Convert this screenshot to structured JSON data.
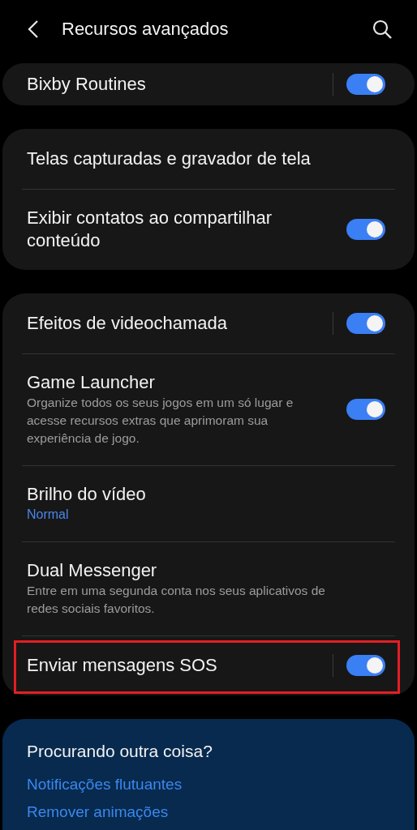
{
  "header": {
    "title": "Recursos avançados"
  },
  "sections": [
    {
      "rows": [
        {
          "title": "Bixby Routines",
          "divider": true,
          "switch": {
            "on": true
          },
          "highlighted": false
        }
      ]
    },
    {
      "rows": [
        {
          "title": "Telas capturadas e gravador de tela",
          "divider": false,
          "highlighted": false
        },
        {
          "title": "Exibir contatos ao compartilhar conteúdo",
          "divider": false,
          "switch": {
            "on": true
          },
          "highlighted": false
        }
      ]
    },
    {
      "rows": [
        {
          "title": "Efeitos de videochamada",
          "divider": true,
          "switch": {
            "on": true
          },
          "highlighted": false
        },
        {
          "title": "Game Launcher",
          "summary": "Organize todos os seus jogos em um só lugar e acesse recursos extras que aprimoram sua experiência de jogo.",
          "divider": false,
          "switch": {
            "on": true
          },
          "highlighted": false
        },
        {
          "title": "Brilho do vídeo",
          "value": "Normal",
          "divider": false,
          "highlighted": false
        },
        {
          "title": "Dual Messenger",
          "summary": "Entre em uma segunda conta nos seus aplicativos de redes sociais favoritos.",
          "divider": false,
          "highlighted": false
        },
        {
          "title": "Enviar mensagens SOS",
          "divider": true,
          "switch": {
            "on": true
          },
          "highlighted": true
        }
      ]
    }
  ],
  "suggestions": {
    "title": "Procurando outra coisa?",
    "links": [
      "Notificações flutuantes",
      "Remover animações"
    ]
  }
}
